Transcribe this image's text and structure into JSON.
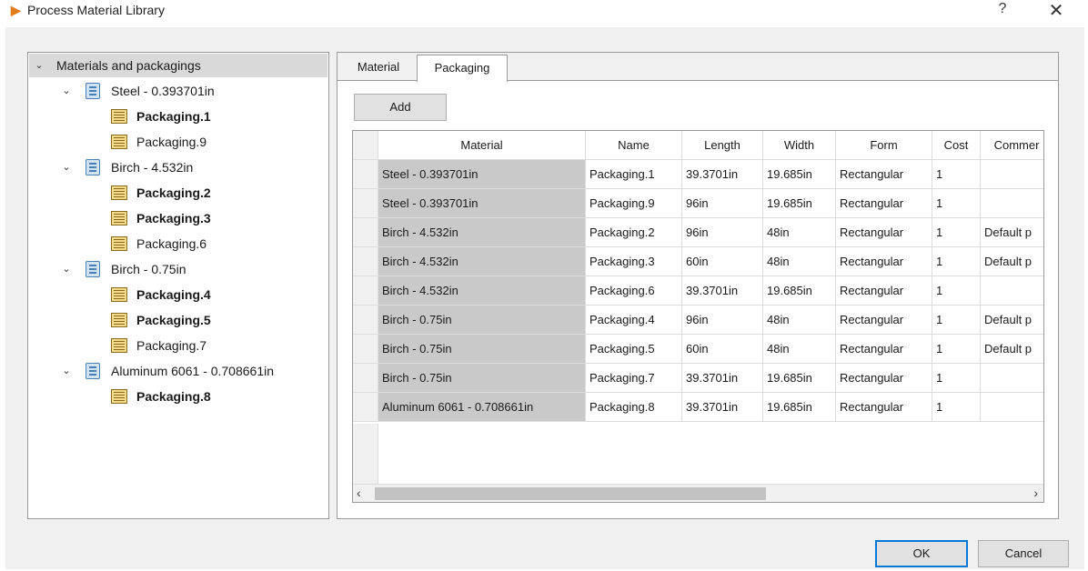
{
  "window": {
    "title": "Process Material Library",
    "help": "?",
    "close": "✕"
  },
  "tree": {
    "root": "Materials and packagings",
    "nodes": [
      {
        "label": "Steel - 0.393701in",
        "children": [
          {
            "label": "Packaging.1",
            "bold": true
          },
          {
            "label": "Packaging.9",
            "bold": false
          }
        ]
      },
      {
        "label": "Birch - 4.532in",
        "children": [
          {
            "label": "Packaging.2",
            "bold": true
          },
          {
            "label": "Packaging.3",
            "bold": true
          },
          {
            "label": "Packaging.6",
            "bold": false
          }
        ]
      },
      {
        "label": "Birch - 0.75in",
        "children": [
          {
            "label": "Packaging.4",
            "bold": true
          },
          {
            "label": "Packaging.5",
            "bold": true
          },
          {
            "label": "Packaging.7",
            "bold": false
          }
        ]
      },
      {
        "label": "Aluminum 6061 - 0.708661in",
        "children": [
          {
            "label": "Packaging.8",
            "bold": true
          }
        ]
      }
    ]
  },
  "tabs": {
    "material": "Material",
    "packaging": "Packaging",
    "active": "packaging"
  },
  "toolbar": {
    "add_label": "Add"
  },
  "table": {
    "columns": [
      "Material",
      "Name",
      "Length",
      "Width",
      "Form",
      "Cost",
      "Commer"
    ],
    "rows": [
      [
        "Steel - 0.393701in",
        "Packaging.1",
        "39.3701in",
        "19.685in",
        "Rectangular",
        "1",
        ""
      ],
      [
        "Steel - 0.393701in",
        "Packaging.9",
        "96in",
        "19.685in",
        "Rectangular",
        "1",
        ""
      ],
      [
        "Birch - 4.532in",
        "Packaging.2",
        "96in",
        "48in",
        "Rectangular",
        "1",
        "Default p"
      ],
      [
        "Birch - 4.532in",
        "Packaging.3",
        "60in",
        "48in",
        "Rectangular",
        "1",
        "Default p"
      ],
      [
        "Birch - 4.532in",
        "Packaging.6",
        "39.3701in",
        "19.685in",
        "Rectangular",
        "1",
        ""
      ],
      [
        "Birch - 0.75in",
        "Packaging.4",
        "96in",
        "48in",
        "Rectangular",
        "1",
        "Default p"
      ],
      [
        "Birch - 0.75in",
        "Packaging.5",
        "60in",
        "48in",
        "Rectangular",
        "1",
        "Default p"
      ],
      [
        "Birch - 0.75in",
        "Packaging.7",
        "39.3701in",
        "19.685in",
        "Rectangular",
        "1",
        ""
      ],
      [
        "Aluminum 6061 - 0.708661in",
        "Packaging.8",
        "39.3701in",
        "19.685in",
        "Rectangular",
        "1",
        ""
      ]
    ]
  },
  "scroll": {
    "left_arrow": "‹",
    "right_arrow": "›"
  },
  "footer": {
    "ok_label": "OK",
    "cancel_label": "Cancel"
  }
}
